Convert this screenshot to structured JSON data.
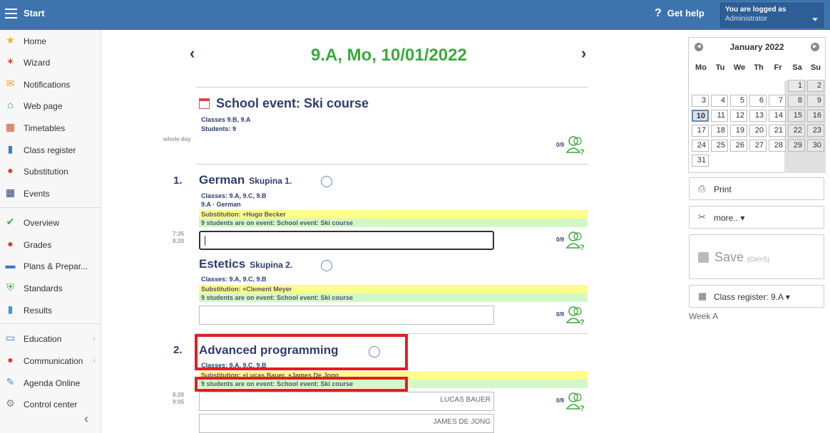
{
  "topbar": {
    "start_label": "Start",
    "help_label": "Get help",
    "login_line1": "You are logged as",
    "login_line2": "Administrator"
  },
  "sidebar": {
    "items": [
      {
        "label": "Home",
        "icon": "star-icon",
        "color": "#f2b21c"
      },
      {
        "label": "Wizard",
        "icon": "wand-icon",
        "color": "#d9412f"
      },
      {
        "label": "Notifications",
        "icon": "envelope-icon",
        "color": "#f0a030"
      },
      {
        "label": "Web page",
        "icon": "house-icon",
        "color": "#2f9a7b"
      },
      {
        "label": "Timetables",
        "icon": "table-icon",
        "color": "#c94f2c"
      },
      {
        "label": "Class register",
        "icon": "book-icon",
        "color": "#3a7ec8"
      },
      {
        "label": "Substitution",
        "icon": "person-icon",
        "color": "#d9412f"
      },
      {
        "label": "Events",
        "icon": "calendar-icon",
        "color": "#2e3d70"
      },
      {
        "label": "Overview",
        "icon": "check-circle-icon",
        "color": "#3aaa3a"
      },
      {
        "label": "Grades",
        "icon": "grade-icon",
        "color": "#d9412f"
      },
      {
        "label": "Plans & Prepar...",
        "icon": "briefcase-icon",
        "color": "#3a7ec8"
      },
      {
        "label": "Standards",
        "icon": "shield-icon",
        "color": "#3aaa3a"
      },
      {
        "label": "Results",
        "icon": "bar-chart-icon",
        "color": "#3a9ad0"
      },
      {
        "label": "Education",
        "icon": "open-book-icon",
        "color": "#3a7ec8"
      },
      {
        "label": "Communication",
        "icon": "chat-icon",
        "color": "#d9412f"
      },
      {
        "label": "Agenda Online",
        "icon": "pen-icon",
        "color": "#3a9ad0"
      },
      {
        "label": "Control center",
        "icon": "gear-icon",
        "color": "#888888"
      }
    ]
  },
  "main": {
    "date_title": "9.A, Mo, 10/01/2022",
    "event": {
      "title": "School event: Ski course",
      "classes": "Classes  9.B, 9.A",
      "students": "Students:  9",
      "whole_day": "whole day",
      "score": "0/9"
    },
    "lessons": [
      {
        "number": "1.",
        "time1": "7:35",
        "time2": "8:20",
        "subjects": [
          {
            "name": "German",
            "group": "Skupina 1.",
            "classes": "Classes:  9.A, 9.C, 9.B",
            "subline": "9.A · German",
            "substitution": "Substitution:   +Hugo Becker",
            "event_note": "9 students are on event: School event: Ski course",
            "score": "0/9"
          },
          {
            "name": "Estetics",
            "group": "Skupina 2.",
            "classes": "Classes:  9.A, 9.C, 9.B",
            "substitution": "Substitution:   +Clement Meyer",
            "event_note": "9 students are on event: School event: Ski course",
            "score": "0/9"
          }
        ]
      },
      {
        "number": "2.",
        "time1": "8:20",
        "time2": "9:05",
        "subjects": [
          {
            "name": "Advanced programming",
            "classes": "Classes:  9.A, 9.C, 9.B",
            "substitution": "Substitution:   +Lucas Bauer, +James De Jong",
            "event_note": "9 students are on event: School event: Ski course",
            "teachers": [
              "LUCAS BAUER",
              "JAMES DE JONG"
            ],
            "score": "0/9"
          }
        ]
      }
    ]
  },
  "calendar": {
    "month": "January 2022",
    "weekdays": [
      "Mo",
      "Tu",
      "We",
      "Th",
      "Fr",
      "Sa",
      "Su"
    ],
    "today": "10"
  },
  "right": {
    "print_label": "Print",
    "more_label": "more.. ▾",
    "save_label": "Save",
    "save_shortcut": "(Ctrl+S)",
    "register_label": "Class register: 9.A ▾",
    "week_label": "Week A"
  }
}
